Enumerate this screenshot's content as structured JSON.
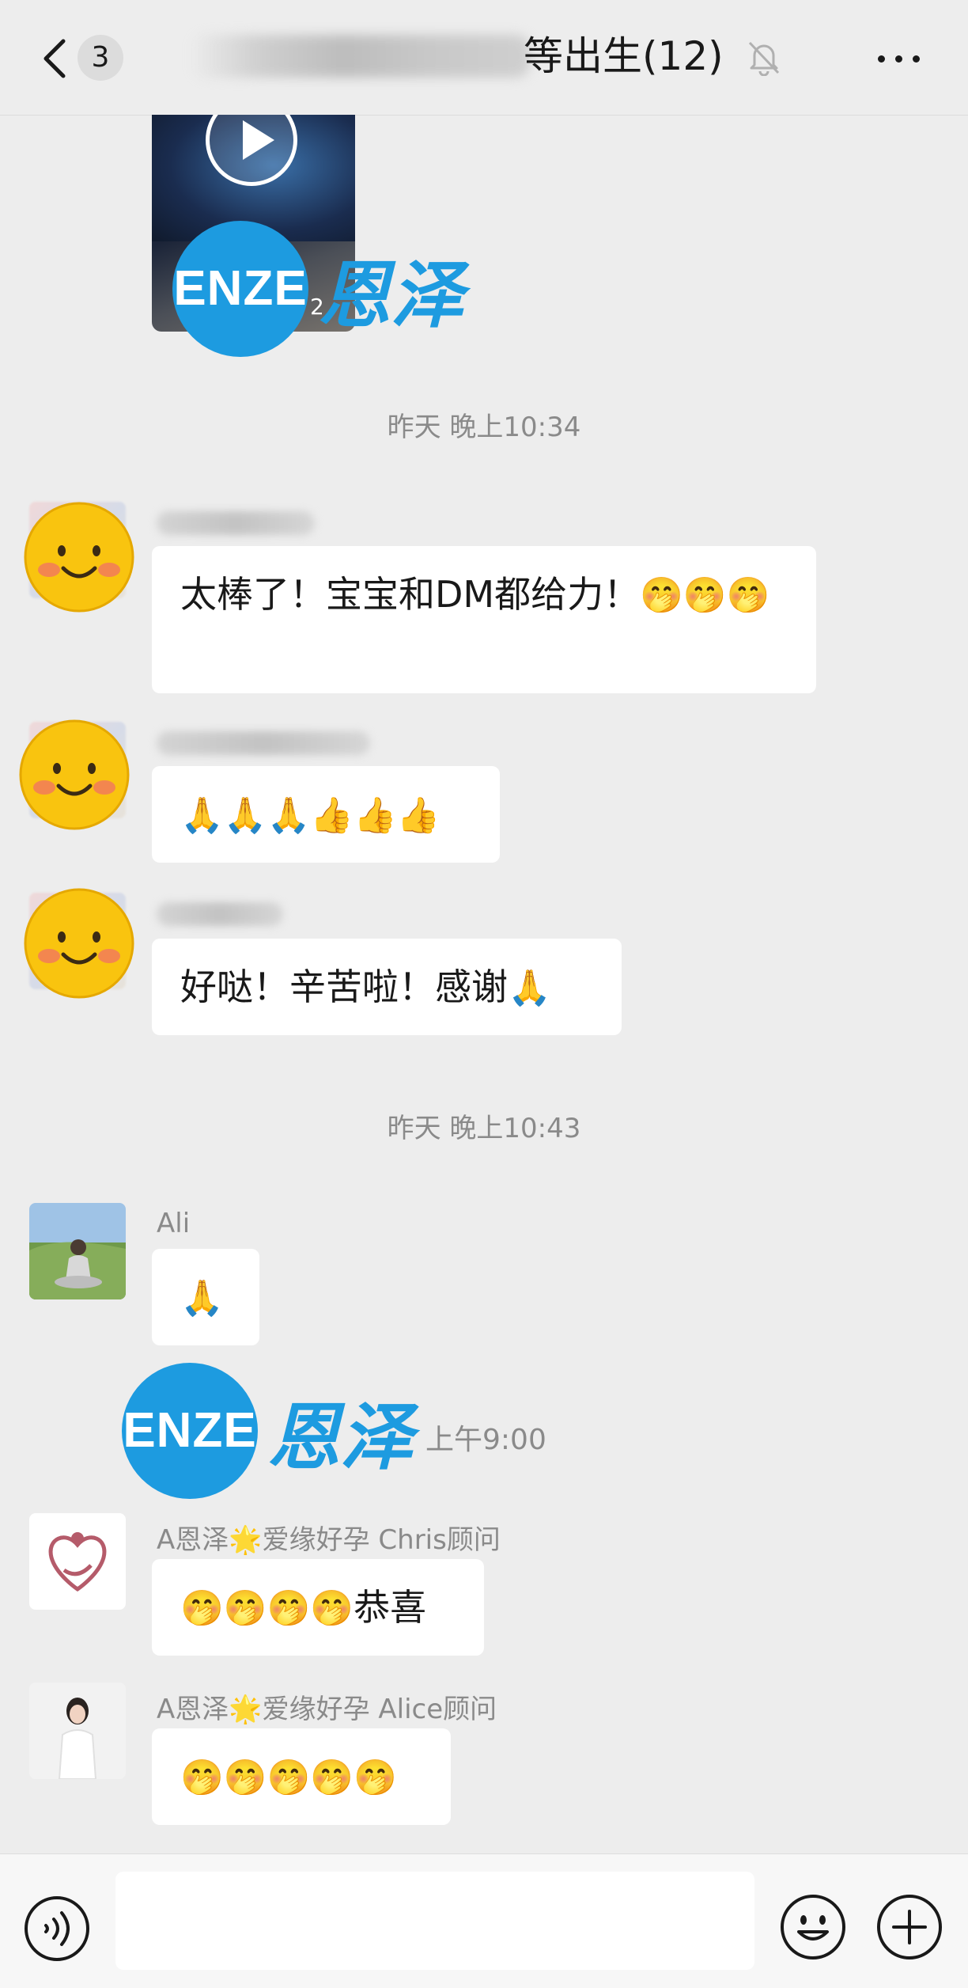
{
  "header": {
    "unread_count": "3",
    "title": "等出生(12)",
    "icons": {
      "back": "chevron-left-icon",
      "mute": "bell-muted-icon",
      "more": "more-dots-icon"
    }
  },
  "video": {
    "duration": "2"
  },
  "watermark": {
    "brand_en": "ENZE",
    "brand_cn": "恩泽",
    "color": "#1d9be0"
  },
  "timestamps": [
    "昨天 晚上10:34",
    "昨天 晚上10:43"
  ],
  "logo_time": "上午9:00",
  "messages": [
    {
      "sender": "",
      "text": "太棒了！宝宝和DM都给力！",
      "emoji": "🤭🤭🤭"
    },
    {
      "sender": "",
      "text": "",
      "emoji": "🙏🙏🙏👍👍👍"
    },
    {
      "sender": "",
      "text": "好哒！辛苦啦！感谢",
      "emoji": "🙏"
    },
    {
      "sender": "Ali",
      "text": "",
      "emoji": "🙏"
    },
    {
      "sender": "A恩泽🌟爱缘好孕 Chris顾问",
      "text": "恭喜",
      "emoji": "🤭🤭🤭🤭"
    },
    {
      "sender": "A恩泽🌟爱缘好孕 Alice顾问",
      "text": "",
      "emoji": "🤭🤭🤭🤭🤭"
    }
  ],
  "input_bar": {
    "placeholder": "",
    "icons": {
      "voice": "voice-icon",
      "emoji": "emoji-icon",
      "plus": "plus-icon"
    }
  },
  "colors": {
    "background": "#ededed",
    "bubble": "#ffffff",
    "timestamp": "#8a8a8a",
    "accent": "#1d9be0"
  }
}
